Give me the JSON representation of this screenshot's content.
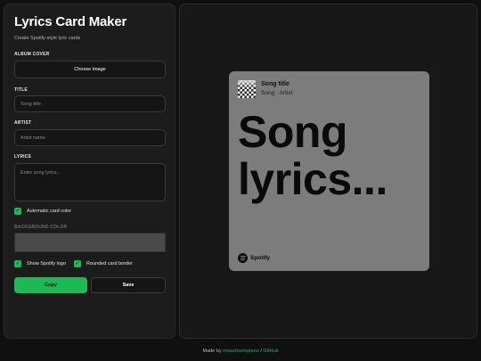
{
  "app": {
    "title": "Lyrics Card Maker",
    "subtitle": "Create Spotify-style lyric cards"
  },
  "form": {
    "album_cover_label": "ALBUM COVER",
    "choose_image_label": "Choose image",
    "title_label": "TITLE",
    "title_placeholder": "Song title",
    "artist_label": "ARTIST",
    "artist_placeholder": "Artist name",
    "lyrics_label": "LYRICS",
    "lyrics_placeholder": "Enter song lyrics...",
    "auto_color_label": "Automatic card color",
    "auto_color_checked": true,
    "background_color_label": "BACKGROUND COLOR",
    "background_color_value": "#4a4a4a",
    "show_logo_label": "Show Spotify logo",
    "show_logo_checked": true,
    "rounded_border_label": "Rounded card border",
    "rounded_border_checked": true,
    "copy_label": "Copy",
    "save_label": "Save"
  },
  "preview": {
    "song_title": "Song title",
    "song_subtitle": "Song · Artist",
    "lyrics": "Song lyrics...",
    "brand": "Spotify",
    "card_color": "#7c7c7c"
  },
  "footer": {
    "prefix": "Made by",
    "author": "mozartsempiano",
    "separator": "/",
    "github": "GitHub"
  },
  "colors": {
    "accent": "#1db954",
    "background": "#101010",
    "panel": "#1c1c1c"
  }
}
